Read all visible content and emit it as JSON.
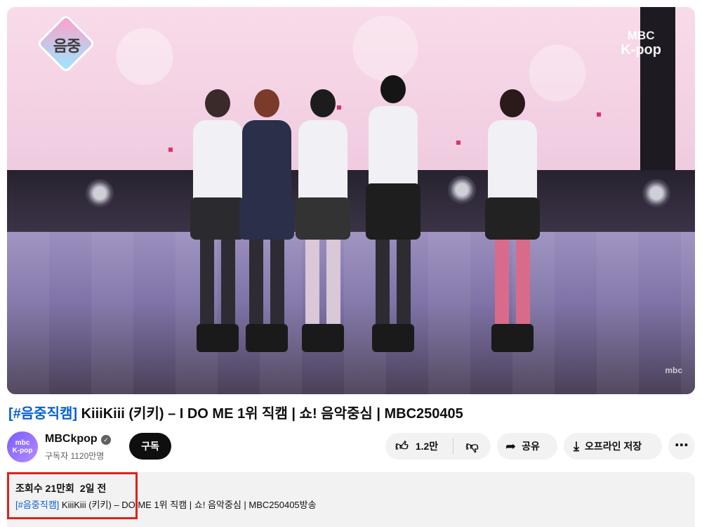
{
  "player": {
    "show_logo": "음중",
    "watermark_top_line1": "MBC",
    "watermark_top_line2": "K-pop",
    "watermark_bottom": "mbc"
  },
  "title": {
    "tag": "[#음중직캠]",
    "text": " KiiiKiii (키키) – I DO ME 1위 직캠 | 쇼! 음악중심 | MBC250405"
  },
  "channel": {
    "avatar_text_1": "mbc",
    "avatar_text_2": "K-pop",
    "name": "MBCkpop",
    "verified_icon": "✓",
    "subscribers": "구독자 1120만명",
    "subscribe_label": "구독"
  },
  "actions": {
    "like_count": "1.2만",
    "share_label": "공유",
    "save_label": "오프라인 저장",
    "more_label": "⋯"
  },
  "description": {
    "views": "조회수 21만회",
    "date": "2일 전",
    "tag": "[#음중직캠]",
    "text": " KiiiKiii (키키) –   DO ME 1위 직캠 | 쇼! 음악중심 | MBC250405방송"
  },
  "colors": {
    "link_blue": "#065fd4",
    "highlight_red": "#e0201d",
    "subscribe_bg": "#0f0f0f"
  }
}
